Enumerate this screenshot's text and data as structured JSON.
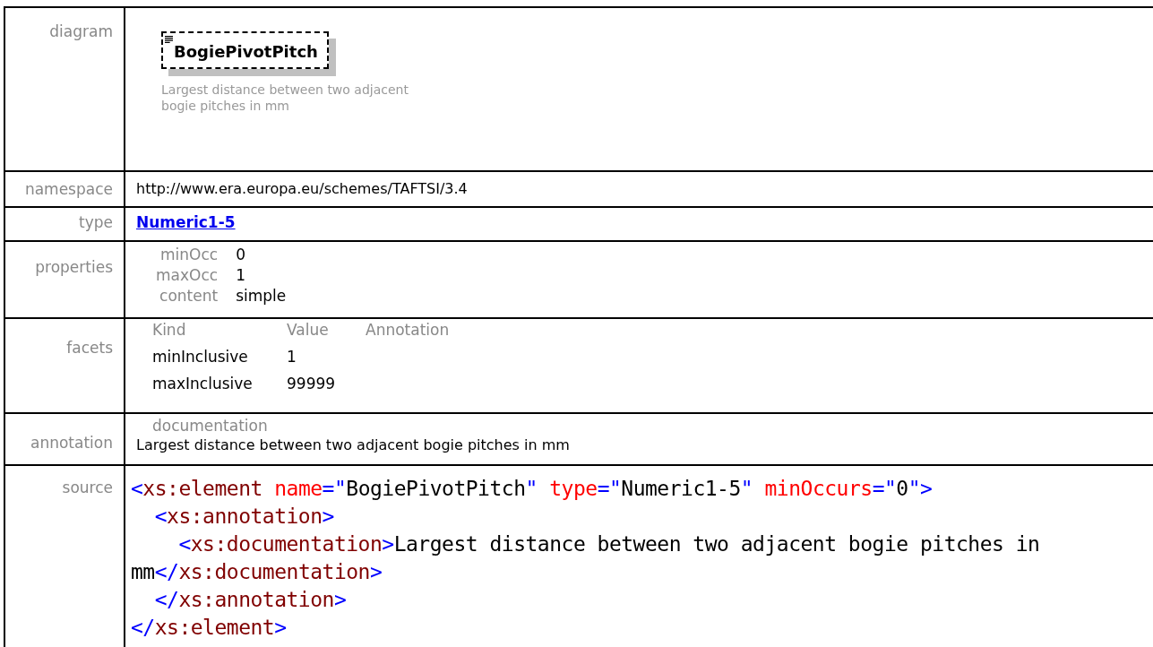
{
  "rows": [
    {
      "kind": "diagram",
      "label": "diagram",
      "element": "BogiePivotPitch",
      "description": "Largest distance between two adjacent bogie pitches in mm"
    },
    {
      "kind": "text",
      "label": "namespace",
      "value": "http://www.era.europa.eu/schemes/TAFTSI/3.4"
    },
    {
      "kind": "link",
      "label": "type",
      "value": "Numeric1-5"
    },
    {
      "kind": "properties",
      "label": "properties",
      "items": [
        {
          "name": "minOcc",
          "value": "0"
        },
        {
          "name": "maxOcc",
          "value": "1"
        },
        {
          "name": "content",
          "value": "simple"
        }
      ]
    },
    {
      "kind": "facets",
      "label": "facets",
      "columns": [
        "Kind",
        "Value",
        "Annotation"
      ],
      "items": [
        {
          "kind": "minInclusive",
          "value": "1"
        },
        {
          "kind": "maxInclusive",
          "value": "99999"
        }
      ]
    },
    {
      "kind": "annotation",
      "label": "annotation",
      "heading": "documentation",
      "text": "Largest distance between two adjacent bogie pitches in mm"
    },
    {
      "kind": "source",
      "label": "source",
      "lines": [
        [
          {
            "kind": "bracket",
            "s": "<"
          },
          {
            "kind": "tag",
            "s": "xs:element"
          },
          {
            "kind": "attr",
            "s": " name"
          },
          {
            "kind": "bracket",
            "s": "=\""
          },
          {
            "kind": "plain",
            "s": "BogiePivotPitch"
          },
          {
            "kind": "bracket",
            "s": "\""
          },
          {
            "kind": "attr",
            "s": " type"
          },
          {
            "kind": "bracket",
            "s": "=\""
          },
          {
            "kind": "plain",
            "s": "Numeric1-5"
          },
          {
            "kind": "bracket",
            "s": "\""
          },
          {
            "kind": "attr",
            "s": " minOccurs"
          },
          {
            "kind": "bracket",
            "s": "=\""
          },
          {
            "kind": "plain",
            "s": "0"
          },
          {
            "kind": "bracket",
            "s": "\">"
          }
        ],
        [
          {
            "kind": "bracket",
            "s": "  <"
          },
          {
            "kind": "tag",
            "s": "xs:annotation"
          },
          {
            "kind": "bracket",
            "s": ">"
          }
        ],
        [
          {
            "kind": "bracket",
            "s": "    <"
          },
          {
            "kind": "tag",
            "s": "xs:documentation"
          },
          {
            "kind": "bracket",
            "s": ">"
          },
          {
            "kind": "plain",
            "s": "Largest distance between two adjacent bogie pitches in"
          }
        ],
        [
          {
            "kind": "plain",
            "s": "mm"
          },
          {
            "kind": "bracket",
            "s": "</"
          },
          {
            "kind": "tag",
            "s": "xs:documentation"
          },
          {
            "kind": "bracket",
            "s": ">"
          }
        ],
        [
          {
            "kind": "bracket",
            "s": "  </"
          },
          {
            "kind": "tag",
            "s": "xs:annotation"
          },
          {
            "kind": "bracket",
            "s": ">"
          }
        ],
        [
          {
            "kind": "bracket",
            "s": "</"
          },
          {
            "kind": "tag",
            "s": "xs:element"
          },
          {
            "kind": "bracket",
            "s": ">"
          }
        ]
      ]
    }
  ]
}
